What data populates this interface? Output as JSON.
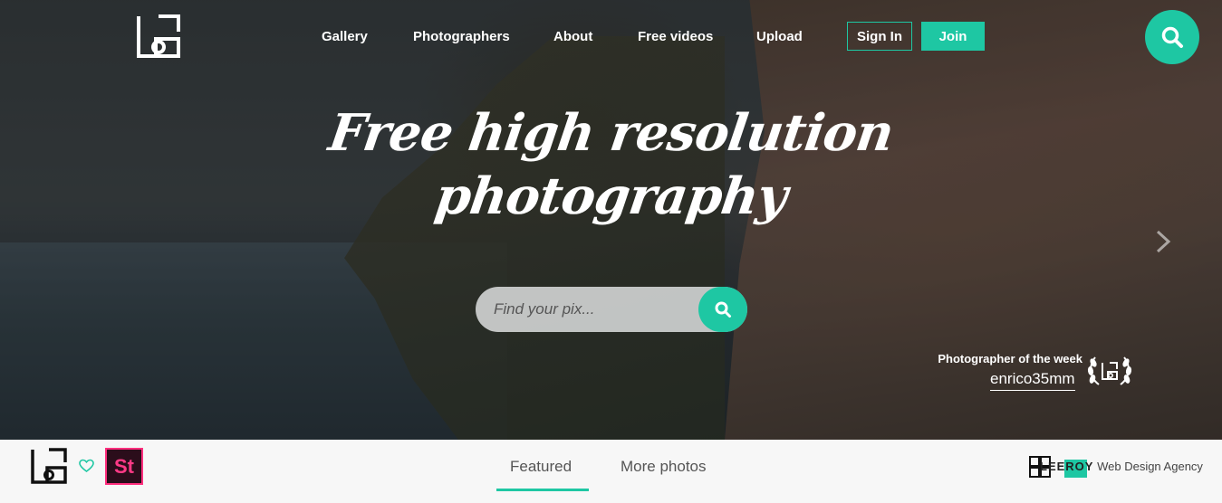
{
  "colors": {
    "accent": "#1ec7a3",
    "stock_pink": "#ff2f7e"
  },
  "header": {
    "logo": "site-logo",
    "nav": [
      "Gallery",
      "Photographers",
      "About",
      "Free videos",
      "Upload"
    ],
    "signin_label": "Sign In",
    "join_label": "Join",
    "search_icon": "search-icon"
  },
  "hero": {
    "headline_line1": "Free high resolution",
    "headline_line2": "photography",
    "search_placeholder": "Find your pix...",
    "next_icon": "chevron-right-icon",
    "photographer_label": "Photographer of the week",
    "photographer_name": "enrico35mm"
  },
  "footer_bar": {
    "stock_badge": "St",
    "tabs": [
      "Featured",
      "More photos"
    ],
    "active_tab": "Featured",
    "agency_brand": "LEEROY",
    "agency_text": "Web Design Agency"
  }
}
